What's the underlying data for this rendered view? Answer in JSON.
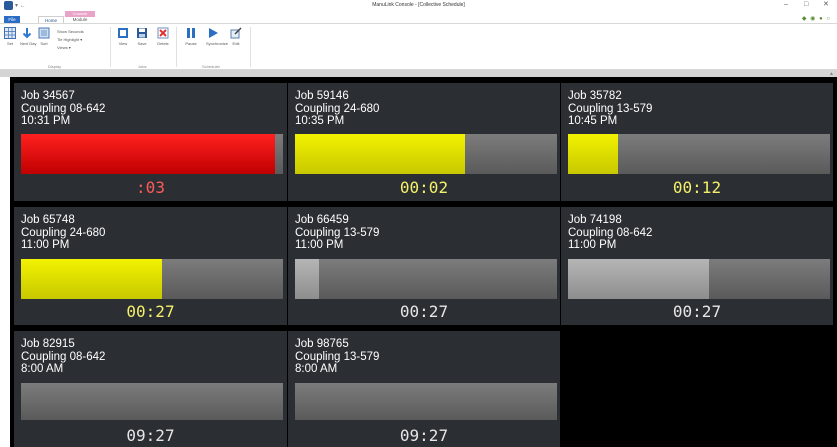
{
  "window": {
    "title": "ManuLink Console - [Collective Schedule]",
    "quick_access": "▾ ←",
    "min": "–",
    "max": "□",
    "close": "✕"
  },
  "ribbon": {
    "contextual_group": "Console",
    "tabs": {
      "file": "File",
      "home": "Home",
      "module": "Module"
    },
    "right_icons": "◆ ◉ ● ○",
    "buttons": {
      "set": "Set",
      "next_day": "Next Day",
      "sort": "Sort",
      "view": "View",
      "save": "Save",
      "delete": "Delete",
      "pause": "Pause",
      "synchronize": "Synchronize",
      "edit": "Edit"
    },
    "options": {
      "show_seconds": "Show Seconds",
      "tie_highlight": "Tie Highlight ▾",
      "views": "Views ▾"
    },
    "groups": {
      "display": "Display",
      "jobs": "Jobs",
      "scheduler": "Scheduler"
    }
  },
  "jobs": [
    {
      "job": "Job 34567",
      "coupling": "Coupling 08-642",
      "time": "10:31 PM",
      "progress": 0.97,
      "fill_color": "red",
      "timer": ":03",
      "timer_color": "red"
    },
    {
      "job": "Job 59146",
      "coupling": "Coupling 24-680",
      "time": "10:35 PM",
      "progress": 0.65,
      "fill_color": "yellow",
      "timer": "00:02",
      "timer_color": "yellow"
    },
    {
      "job": "Job 35782",
      "coupling": "Coupling 13-579",
      "time": "10:45 PM",
      "progress": 0.19,
      "fill_color": "yellow",
      "timer": "00:12",
      "timer_color": "yellow"
    },
    {
      "job": "Job 65748",
      "coupling": "Coupling 24-680",
      "time": "11:00 PM",
      "progress": 0.54,
      "fill_color": "yellow",
      "timer": "00:27",
      "timer_color": "yellow"
    },
    {
      "job": "Job 66459",
      "coupling": "Coupling 13-579",
      "time": "11:00 PM",
      "progress": 0.09,
      "fill_color": "grey",
      "timer": "00:27",
      "timer_color": "white"
    },
    {
      "job": "Job 74198",
      "coupling": "Coupling 08-642",
      "time": "11:00 PM",
      "progress": 0.54,
      "fill_color": "grey",
      "timer": "00:27",
      "timer_color": "white"
    },
    {
      "job": "Job 82915",
      "coupling": "Coupling 08-642",
      "time": "8:00 AM",
      "progress": 0,
      "fill_color": "grey",
      "timer": "09:27",
      "timer_color": "white"
    },
    {
      "job": "Job 98765",
      "coupling": "Coupling 13-579",
      "time": "8:00 AM",
      "progress": 0,
      "fill_color": "grey",
      "timer": "09:27",
      "timer_color": "white"
    }
  ]
}
